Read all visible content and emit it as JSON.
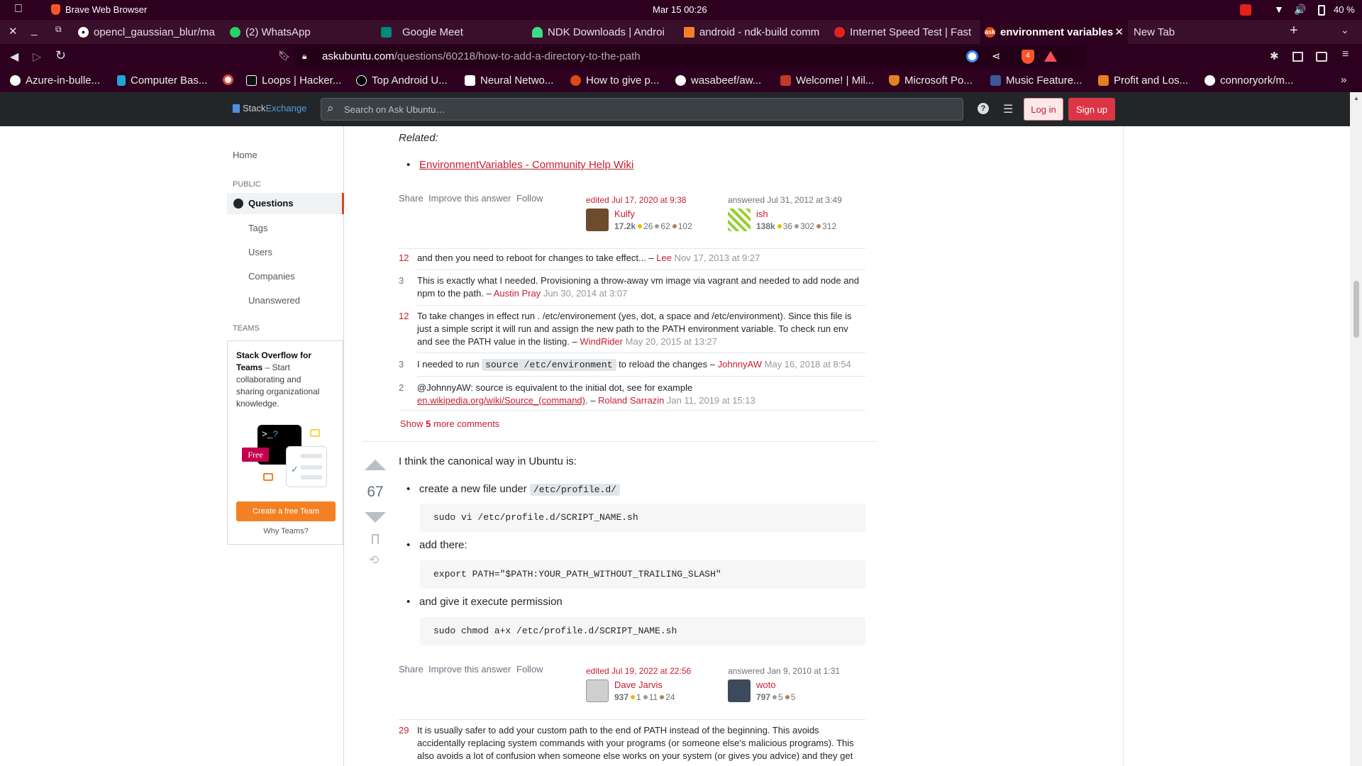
{
  "os": {
    "browser": "Brave Web Browser",
    "datetime": "Mar 15  00:26",
    "battery": "40 %"
  },
  "tabs": [
    {
      "label": "opencl_gaussian_blur/ma",
      "color": "#ffffff"
    },
    {
      "label": "(2) WhatsApp",
      "color": "#25d366"
    },
    {
      "label": "Google Meet",
      "color": "#00897b"
    },
    {
      "label": "NDK Downloads  |  Androi",
      "color": "#3ddc84"
    },
    {
      "label": "android - ndk-build comm",
      "color": "#f48024"
    },
    {
      "label": "Internet Speed Test | Fast",
      "color": "#e2231a"
    },
    {
      "label": "environment variables",
      "color": "#dd4814"
    },
    {
      "label": "New Tab",
      "color": ""
    }
  ],
  "toolbar": {
    "url_host": "askubuntu.com",
    "url_path": "/questions/60218/how-to-add-a-directory-to-the-path",
    "shield_count": "4"
  },
  "bookmarks": [
    {
      "label": "Azure-in-bulle...",
      "color": "#ffffff"
    },
    {
      "label": "Computer Bas...",
      "color": "#21a5d9"
    },
    {
      "label": "",
      "color": "#ffffff"
    },
    {
      "label": "Loops | Hacker...",
      "color": "#111111"
    },
    {
      "label": "Top Android U...",
      "color": "#000000"
    },
    {
      "label": "Neural Netwo...",
      "color": "#ffffff"
    },
    {
      "label": "How to give p...",
      "color": "#dd4814"
    },
    {
      "label": "wasabeef/aw...",
      "color": "#ffffff"
    },
    {
      "label": "Welcome! | Mil...",
      "color": "#c0392b"
    },
    {
      "label": "Microsoft Po...",
      "color": "#e67e22"
    },
    {
      "label": "Music Feature...",
      "color": "#3b5998"
    },
    {
      "label": "Profit and Los...",
      "color": "#e67e22"
    },
    {
      "label": "connoryork/m...",
      "color": "#ffffff"
    }
  ],
  "header": {
    "logo_a": "Stack",
    "logo_b": "Exchange",
    "search_placeholder": "Search on Ask Ubuntu…",
    "login": "Log in",
    "signup": "Sign up"
  },
  "sidebar": {
    "home": "Home",
    "public": "PUBLIC",
    "questions": "Questions",
    "tags": "Tags",
    "users": "Users",
    "companies": "Companies",
    "unanswered": "Unanswered",
    "teams": "TEAMS",
    "teams_title": "Stack Overflow for Teams",
    "teams_text1": " – Start",
    "teams_text2": "collaborating and",
    "teams_text3": "sharing organizational",
    "teams_text4": "knowledge.",
    "free": "Free",
    "create": "Create a free Team",
    "why": "Why Teams?"
  },
  "answer1": {
    "related_label": "Related:",
    "related_link": "EnvironmentVariables - Community Help Wiki",
    "share": "Share",
    "improve": "Improve this answer",
    "follow": "Follow",
    "edited": "edited Jul 17, 2020 at 9:38",
    "editor": "Kulfy",
    "editor_rep": "17.2k",
    "editor_gold": "26",
    "editor_silver": "62",
    "editor_bronze": "102",
    "answered": "answered Jul 31, 2012 at 3:49",
    "author": "ish",
    "author_rep": "138k",
    "author_gold": "36",
    "author_silver": "302",
    "author_bronze": "312"
  },
  "comments": [
    {
      "score": "12",
      "text": "and then you need to reboot for changes to take effect... – ",
      "user": "Lee",
      "date": "Nov 17, 2013 at 9:27"
    },
    {
      "score": "3",
      "text1": "This is exactly what I needed. Provisioning a throw-away vm image via vagrant and needed to add node and",
      "text2": "npm to the path. – ",
      "user": "Austin Pray",
      "date": "Jun 30, 2014 at 3:07"
    },
    {
      "score": "12",
      "text1": "To take changes in effect run . /etc/environement (yes, dot, a space and /etc/environment). Since this file is",
      "text2": "just a simple script it will run and assign the new path to the PATH environment variable. To check run env",
      "text3": "and see the PATH value in the listing. – ",
      "user": "WindRider",
      "date": "May 20, 2015 at 13:27"
    },
    {
      "score": "3",
      "text_a": "I needed to run ",
      "code": "source /etc/environment",
      "text_b": " to reload the changes – ",
      "user": "JohnnyAW",
      "date": "May 16, 2018 at 8:54"
    },
    {
      "score": "2",
      "text1": "@JohnnyAW: source is equivalent to the initial dot, see for example",
      "link": "en.wikipedia.org/wiki/Source_(command)",
      "text2": ". – ",
      "user": "Roland Sarrazin",
      "date": "Jan 11, 2019 at 15:13"
    }
  ],
  "show_more": {
    "a": "Show ",
    "n": "5",
    "b": " more comments"
  },
  "answer2": {
    "votes": "67",
    "intro": "I think the canonical way in Ubuntu is:",
    "b1": "create a new file under ",
    "b1_code": "/etc/profile.d/",
    "pre1": "sudo vi /etc/profile.d/SCRIPT_NAME.sh",
    "b2": "add there:",
    "pre2": "export PATH=\"$PATH:YOUR_PATH_WITHOUT_TRAILING_SLASH\"",
    "b3": "and give it execute permission",
    "pre3": "sudo chmod a+x /etc/profile.d/SCRIPT_NAME.sh",
    "share": "Share",
    "improve": "Improve this answer",
    "follow": "Follow",
    "edited": "edited Jul 19, 2022 at 22:56",
    "editor": "Dave Jarvis",
    "editor_rep": "937",
    "editor_gold": "1",
    "editor_silver": "11",
    "editor_bronze": "24",
    "answered": "answered Jan 9, 2010 at 1:31",
    "author": "woto",
    "author_rep": "797",
    "author_silver": "5",
    "author_bronze": "5"
  },
  "comment_last": {
    "score": "29",
    "l1": "It is usually safer to add your custom path to the end of PATH instead of the beginning. This avoids",
    "l2": "accidentally replacing system commands with your programs (or someone else's malicious programs). This",
    "l3": "also avoids a lot of confusion when someone else works on your system (or gives you advice) and they get"
  }
}
